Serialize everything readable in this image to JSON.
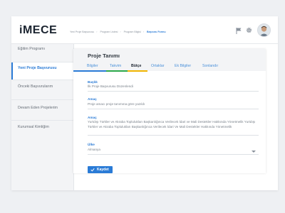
{
  "brand": {
    "logo_text": "iMECE"
  },
  "breadcrumb": [
    "Yeni Proje Başvurusu",
    "Program Listesi",
    "Program Bilgisi",
    "Başvuru Formu"
  ],
  "header_icons": [
    "flag-icon",
    "gear-icon",
    "user-avatar"
  ],
  "sidebar": {
    "items": [
      {
        "label": "Eğitim Programı",
        "active": false
      },
      {
        "label": "Yeni Proje Başvurusu",
        "active": true
      },
      {
        "label": "Önceki Başvurularım",
        "active": false
      },
      {
        "label": "Devam Eden Projelerim",
        "active": false
      },
      {
        "label": "Kurumsal Kimliğim",
        "active": false
      }
    ]
  },
  "card": {
    "title": "Proje Tanımı",
    "tabs": [
      {
        "label": "Bilgiler",
        "active": false
      },
      {
        "label": "Takvim",
        "active": false
      },
      {
        "label": "Bütçe",
        "active": true
      },
      {
        "label": "Ortaklar",
        "active": false
      },
      {
        "label": "Ek Bilgiler",
        "active": false
      },
      {
        "label": "Sonlandır",
        "active": false
      }
    ],
    "tab_colors": {
      "bilgiler": "#2a7bd6",
      "takvim": "#2ba84a",
      "butce": "#f0b400"
    }
  },
  "form": {
    "title_label": "Başlık",
    "title_value": "İlk Proje Başvurusu Düzenlendi",
    "purpose_label": "Amaç",
    "purpose_value": "Proje amacı proje tanımına göre yazıldı",
    "purpose2_label": "Amaç",
    "purpose2_value": "Yurtdışı Türkler ve Akraba Toplulukları Başkanlığınca Verilecek İdari ve Mali Destekler Hakkında Yönetmelik Yurtdışı Türkler ve Akraba Toplulukları Başkanlığınca Verilecek İdari Ve Mali Destekler Hakkında Yönetmelik",
    "country_label": "Ülke",
    "country_value": "Almanya",
    "save_label": "Kaydet"
  },
  "colors": {
    "accent": "#2a7bd6",
    "check": "#ffffff"
  }
}
